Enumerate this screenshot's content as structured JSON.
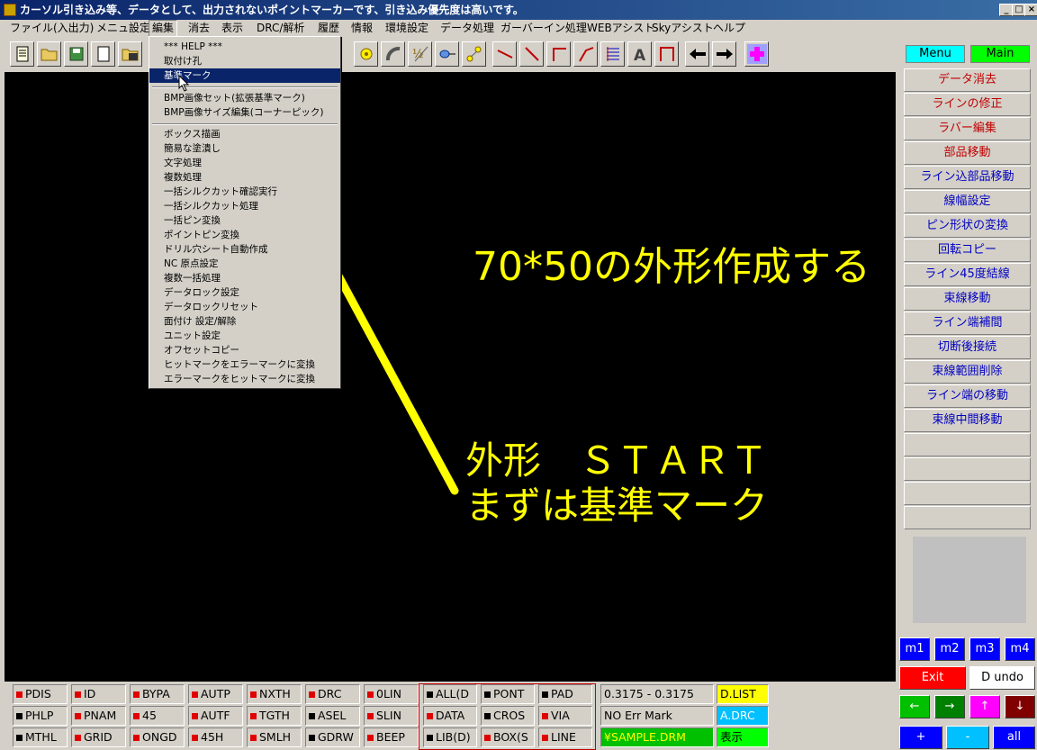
{
  "title": "カーソル引き込み等、データとして、出力されないポイントマーカーです、引き込み優先度は高いです。",
  "window_buttons": {
    "minimize": "_",
    "maximize": "□",
    "close": "×"
  },
  "menu": [
    "ファイル(入出力)",
    "メニュ設定",
    "編集",
    "消去",
    "表示",
    "DRC/解析",
    "履歴",
    "情報",
    "環境設定",
    "データ処理",
    "ガーバーイン処理",
    "WEBアシスト",
    "Skyアシスト",
    "ヘルプ"
  ],
  "menu_active": "編集",
  "dropdown": [
    "*** HELP ***",
    "取付け孔",
    "基準マーク",
    "",
    "BMP画像セット(拡張基準マーク)",
    "BMP画像サイズ編集(コーナーピック)",
    "",
    "ボックス描画",
    "簡易な塗潰し",
    "文字処理",
    "複数処理",
    "一括シルクカット確認実行",
    "一括シルクカット処理",
    "一括ピン変換",
    "ポイントピン変換",
    "ドリル穴シート自動作成",
    "NC 原点設定",
    "複数一括処理",
    "データロック設定",
    "データロックリセット",
    "面付け 設定/解除",
    "ユニット設定",
    "オフセットコピー",
    "ヒットマークをエラーマークに変換",
    "エラーマークをヒットマークに変換"
  ],
  "dropdown_highlight": "基準マーク",
  "annotations": {
    "line1": "70*50の外形作成する",
    "line2": "外形　ＳＴＡＲＴ",
    "line3": "まずは基準マーク",
    "color": "#ffff00"
  },
  "panel_tabs": {
    "menu": "Menu",
    "main": "Main"
  },
  "panel_items": [
    "データ消去",
    "ラインの修正",
    "ラバー編集",
    "部品移動",
    "ライン込部品移動",
    "線幅設定",
    "ピン形状の変換",
    "回転コピー",
    "ライン45度結線",
    "束線移動",
    "ライン端補間",
    "切断後接続",
    "束線範囲削除",
    "ライン端の移動",
    "束線中間移動"
  ],
  "m_buttons": [
    "m1",
    "m2",
    "m3",
    "m4"
  ],
  "exit_label": "Exit",
  "undo_label": "D undo",
  "arrows": {
    "left": "←",
    "right": "→",
    "up": "↑",
    "down": "↓"
  },
  "zoom": {
    "plus": "+",
    "minus": "-",
    "all": "all"
  },
  "toggles_rows": [
    [
      "PDIS",
      "ID",
      "BYPA",
      "AUTP",
      "NXTH",
      "DRC",
      "0LIN"
    ],
    [
      "PHLP",
      "PNAM",
      "45",
      "AUTF",
      "TGTH",
      "ASEL",
      "SLIN"
    ],
    [
      "MTHL",
      "GRID",
      "ONGD",
      "45H",
      "SMLH",
      "GDRW",
      "BEEP"
    ]
  ],
  "toggle_states": [
    [
      "red",
      "red",
      "red",
      "red",
      "red",
      "red",
      "red"
    ],
    [
      "black",
      "red",
      "red",
      "red",
      "red",
      "black",
      "red"
    ],
    [
      "black",
      "red",
      "red",
      "red",
      "red",
      "black",
      "red"
    ]
  ],
  "select_rows": [
    [
      "ALL(D",
      "PONT",
      "PAD"
    ],
    [
      "DATA",
      "CROS",
      "VIA"
    ],
    [
      "LIB(D)",
      "BOX(S",
      "LINE"
    ]
  ],
  "select_states": [
    [
      "black",
      "black",
      "black"
    ],
    [
      "red",
      "black",
      "red"
    ],
    [
      "black",
      "red",
      "red"
    ]
  ],
  "status": {
    "coords": "0.3175 - 0.3175",
    "err": "NO Err Mark",
    "file": "¥SAMPLE.DRM"
  },
  "status_buttons": {
    "dlist": "D.LIST",
    "adrc": "A.DRC",
    "show": "表示"
  },
  "colors": {
    "accent_red": "#c00000",
    "accent_blue": "#0000c0",
    "cyan": "#00ffff",
    "green": "#00ff00",
    "yellow": "#ffff00",
    "mbtn_blue": "#0000ff"
  }
}
